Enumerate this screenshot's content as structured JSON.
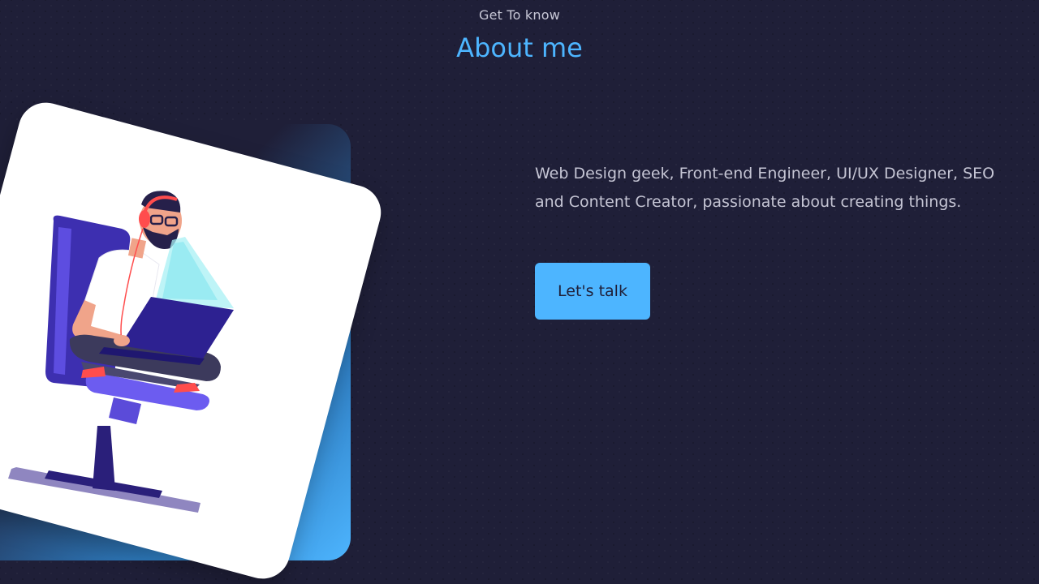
{
  "header": {
    "eyebrow": "Get To know",
    "title": "About me"
  },
  "about": {
    "bio_line_1": "Web Design geek, Front-end Engineer, UI/UX Designer, SEO",
    "bio_line_2": "and Content Creator, passionate about creating things.",
    "cta_label": "Let's talk"
  },
  "colors": {
    "background": "#1f1f38",
    "accent": "#4db5ff",
    "text": "#c5c5d4"
  },
  "illustration": {
    "subject": "person-with-headphones-laptop-chair"
  }
}
